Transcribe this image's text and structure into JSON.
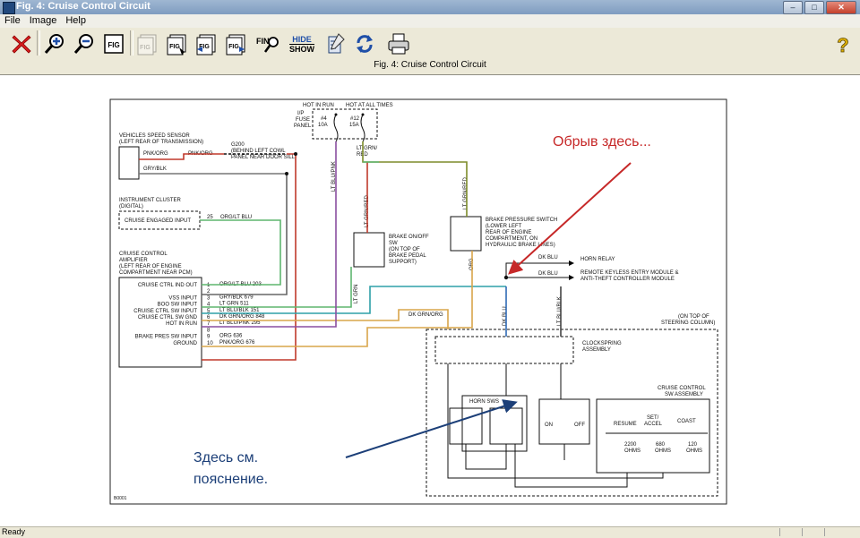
{
  "window": {
    "title": "Fig. 4: Cruise Control Circuit"
  },
  "menu": [
    "File",
    "Image",
    "Help"
  ],
  "toolbar": {
    "find_label": "FIND",
    "hide_label": "HIDE",
    "show_label": "SHOW",
    "fig_label": "FIG"
  },
  "figure": {
    "caption": "Fig. 4: Cruise Control Circuit",
    "fuse_panel": {
      "hot_in_run": "HOT IN RUN",
      "hot_at_all_times": "HOT AT ALL TIMES",
      "ip": "I/P",
      "fuse": "FUSE",
      "panel": "PANEL",
      "fuse4_num": "#4",
      "fuse4_amp": "10A",
      "fuse12_num": "#12",
      "fuse12_amp": "15A"
    },
    "vss": {
      "l1": "VEHICLES SPEED SENSOR",
      "l2": "(LEFT REAR OF TRANSMISSION)"
    },
    "g200": {
      "l1": "G200",
      "l2": "(BEHIND LEFT COWL",
      "l3": "PANEL NEAR DOOR SILL)"
    },
    "instrument_cluster": {
      "l1": "INSTRUMENT CLUSTER",
      "l2": "(DIGITAL)",
      "input": "CRUISE ENGAGED INPUT",
      "pin": "25",
      "wire": "ORG/LT BLU"
    },
    "amplifier": {
      "l1": "CRUISE CONTROL",
      "l2": "AMPLIFIER",
      "l3": "(LEFT REAR OF ENGINE",
      "l4": "COMPARTMENT NEAR PCM)",
      "pins": [
        {
          "label": "CRUISE CTRL IND OUT",
          "num": "1",
          "wire": "ORG/LT BLU 203"
        },
        {
          "label": "",
          "num": "2",
          "wire": ""
        },
        {
          "label": "VSS INPUT",
          "num": "3",
          "wire": "GRY/BLK 679"
        },
        {
          "label": "BOO SW INPUT",
          "num": "4",
          "wire": "LT GRN 511"
        },
        {
          "label": "CRUISE CTRL SW INPUT",
          "num": "5",
          "wire": "LT BLU/BLK 151"
        },
        {
          "label": "CRUISE CTRL SW GND",
          "num": "6",
          "wire": "DK GRN/ORG 848"
        },
        {
          "label": "HOT IN RUN",
          "num": "7",
          "wire": "LT BLU/PNK 295"
        },
        {
          "label": "",
          "num": "8",
          "wire": ""
        },
        {
          "label": "BRAKE PRES SW INPUT",
          "num": "9",
          "wire": "ORG 636"
        },
        {
          "label": "GROUND",
          "num": "10",
          "wire": "PNK/ORG 676"
        }
      ]
    },
    "wires": {
      "pnk_org_1": "PNK/ORG",
      "pnk_org_2": "PNK/ORG",
      "gry_blk": "GRY/BLK",
      "lt_blu_pnk": "LT BLU/PNK",
      "lt_grn_red": "LT GRN/",
      "red": "RED",
      "lt_grn_red_v": "LT GRN/RED",
      "lt_grn_red_v2": "LT GRN/RED",
      "org": "ORG",
      "lt_grn": "LT GRN",
      "dk_grn_org": "DK GRN/ORG",
      "dk_blu_v": "DK BLU",
      "lt_blu_blk_v": "LT BLU/BLK",
      "dk_blu_1": "DK BLU",
      "dk_blu_2": "DK BLU"
    },
    "brake_onoff": {
      "l1": "BRAKE ON/OFF",
      "l2": "SW",
      "l3": "(ON TOP OF",
      "l4": "BRAKE PEDAL",
      "l5": "SUPPORT)"
    },
    "brake_pressure": {
      "l1": "BRAKE PRESSURE SWITCH",
      "l2": "(LOWER LEFT",
      "l3": "REAR OF ENGINE",
      "l4": "COMPARTMENT, ON",
      "l5": "HYDRAULIC BRAKE LINES)"
    },
    "horn_relay": "HORN RELAY",
    "rke": {
      "l1": "REMOTE KEYLESS ENTRY MODULE &",
      "l2": "ANTI-THEFT CONTROLLER MODULE"
    },
    "steering": {
      "l1": "(ON TOP OF",
      "l2": "STEERING COLUMN)"
    },
    "clockspring": {
      "l1": "CLOCKSPRING",
      "l2": "ASSEMBLY"
    },
    "sw_assembly": {
      "l1": "CRUISE CONTROL",
      "l2": "SW ASSEMBLY"
    },
    "horn_sws": "HORN SWS",
    "on": "ON",
    "off": "OFF",
    "resume": "RESUME",
    "set": "SET/",
    "accel": "ACCEL",
    "coast": "COAST",
    "r1": {
      "v": "2200",
      "u": "OHMS"
    },
    "r2": {
      "v": "680",
      "u": "OHMS"
    },
    "r3": {
      "v": "120",
      "u": "OHMS"
    },
    "code": "B0001",
    "annotation_break": "Обрыв здесь...",
    "annotation_see_l1": "Здесь см.",
    "annotation_see_l2": "пояснение."
  },
  "status": {
    "text": "Ready"
  },
  "colors": {
    "red_wire": "#c0392b",
    "green_wire": "#5fb56f",
    "gray_wire": "#777777",
    "blue_wire": "#3a6fbf",
    "teal_wire": "#2fa0a8",
    "purple_wire": "#8a4fa0",
    "orange_wire": "#d9a54a",
    "annotation_red": "#c62828",
    "annotation_blue": "#1c3f78"
  }
}
